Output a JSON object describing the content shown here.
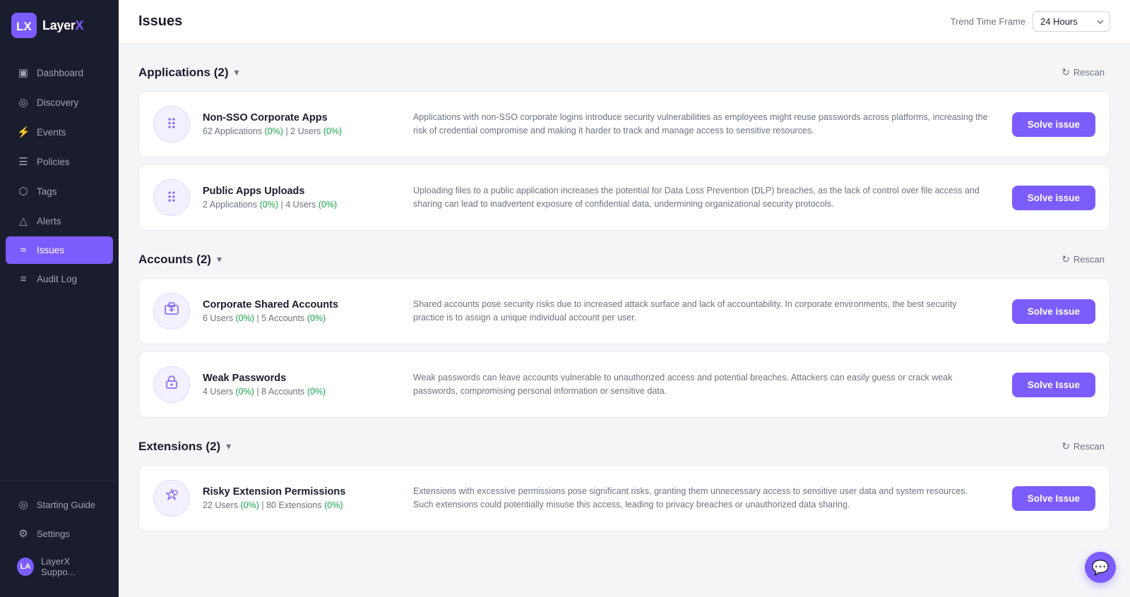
{
  "sidebar": {
    "logo": "LayerX",
    "logo_x": "X",
    "nav_items": [
      {
        "id": "dashboard",
        "label": "Dashboard",
        "icon": "▣",
        "active": false
      },
      {
        "id": "discovery",
        "label": "Discovery",
        "icon": "◎",
        "active": false
      },
      {
        "id": "events",
        "label": "Events",
        "icon": "⚡",
        "active": false
      },
      {
        "id": "policies",
        "label": "Policies",
        "icon": "☰",
        "active": false
      },
      {
        "id": "tags",
        "label": "Tags",
        "icon": "⬡",
        "active": false
      },
      {
        "id": "alerts",
        "label": "Alerts",
        "icon": "△",
        "active": false
      },
      {
        "id": "issues",
        "label": "Issues",
        "icon": "≈",
        "active": true
      },
      {
        "id": "audit-log",
        "label": "Audit Log",
        "icon": "≡",
        "active": false
      }
    ],
    "bottom_items": [
      {
        "id": "starting-guide",
        "label": "Starting Guide",
        "icon": "◎"
      },
      {
        "id": "settings",
        "label": "Settings",
        "icon": "⚙"
      },
      {
        "id": "support",
        "label": "LayerX Suppo...",
        "icon": "avatar"
      }
    ]
  },
  "header": {
    "page_title": "Issues",
    "trend_label": "Trend Time Frame",
    "trend_value": "24 Hours"
  },
  "sections": [
    {
      "id": "applications",
      "title": "Applications (2)",
      "rescan_label": "Rescan",
      "issues": [
        {
          "id": "non-sso",
          "name": "Non-SSO Corporate Apps",
          "meta": "62 Applications (0%) | 2 Users (0%)",
          "meta_parts": [
            {
              "text": "62 Applications "
            },
            {
              "text": "(0%)",
              "green": true
            },
            {
              "text": " | 2 Users "
            },
            {
              "text": "(0%)",
              "green": true
            }
          ],
          "description": "Applications with non-SSO corporate logins introduce security vulnerabilities as employees might reuse passwords across platforms, increasing the risk of credential compromise and making it harder to track and manage access to sensitive resources.",
          "icon": "⠿",
          "solve_label": "Solve issue"
        },
        {
          "id": "public-apps",
          "name": "Public Apps Uploads",
          "meta": "2 Applications (0%) | 4 Users (0%)",
          "meta_parts": [
            {
              "text": "2 Applications "
            },
            {
              "text": "(0%)",
              "green": true
            },
            {
              "text": " | 4 Users "
            },
            {
              "text": "(0%)",
              "green": true
            }
          ],
          "description": "Uploading files to a public application increases the potential for Data Loss Prevention (DLP) breaches, as the lack of control over file access and sharing can lead to inadvertent exposure of confidential data, undermining organizational security protocols.",
          "icon": "⠿",
          "solve_label": "Solve issue"
        }
      ]
    },
    {
      "id": "accounts",
      "title": "Accounts (2)",
      "rescan_label": "Rescan",
      "issues": [
        {
          "id": "shared-accounts",
          "name": "Corporate Shared Accounts",
          "meta": "6 Users (0%) | 5 Accounts (0%)",
          "meta_parts": [
            {
              "text": "6 Users "
            },
            {
              "text": "(0%)",
              "green": true
            },
            {
              "text": " | 5 Accounts "
            },
            {
              "text": "(0%)",
              "green": true
            }
          ],
          "description": "Shared accounts pose security risks due to increased attack surface and lack of accountability. In corporate environments, the best security practice is to assign a unique individual account per user.",
          "icon": "👤",
          "solve_label": "Solve issue"
        },
        {
          "id": "weak-passwords",
          "name": "Weak Passwords",
          "meta": "4 Users (0%) | 8 Accounts (0%)",
          "meta_parts": [
            {
              "text": "4 Users "
            },
            {
              "text": "(0%)",
              "green": true
            },
            {
              "text": " | 8 Accounts "
            },
            {
              "text": "(0%)",
              "green": true
            }
          ],
          "description": "Weak passwords can leave accounts vulnerable to unauthorized access and potential breaches. Attackers can easily guess or crack weak passwords, compromising personal information or sensitive data.",
          "icon": "🔒",
          "solve_label": "Solve Issue"
        }
      ]
    },
    {
      "id": "extensions",
      "title": "Extensions (2)",
      "rescan_label": "Rescan",
      "issues": [
        {
          "id": "risky-extensions",
          "name": "Risky Extension Permissions",
          "meta": "22 Users (0%) | 80 Extensions (0%)",
          "meta_parts": [
            {
              "text": "22 Users "
            },
            {
              "text": "(0%)",
              "green": true
            },
            {
              "text": " | 80 Extensions "
            },
            {
              "text": "(0%)",
              "green": true
            }
          ],
          "description": "Extensions with excessive permissions pose significant risks, granting them unnecessary access to sensitive user data and system resources. Such extensions could potentially misuse this access, leading to privacy breaches or unauthorized data sharing.",
          "icon": "🧩",
          "solve_label": "Solve Issue"
        }
      ]
    }
  ]
}
